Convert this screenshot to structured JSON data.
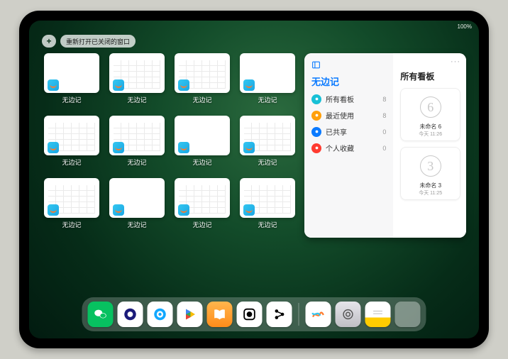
{
  "status": {
    "right": "100%"
  },
  "toolbar": {
    "plus_label": "+",
    "reopen_label": "重新打开已关闭的窗口"
  },
  "windows": {
    "app_label": "无边记",
    "items": [
      {
        "variant": "plain"
      },
      {
        "variant": "cal"
      },
      {
        "variant": "cal"
      },
      {
        "variant": "plain"
      },
      {
        "variant": "cal"
      },
      {
        "variant": "cal"
      },
      {
        "variant": "plain"
      },
      {
        "variant": "cal"
      },
      {
        "variant": "cal"
      },
      {
        "variant": "plain"
      },
      {
        "variant": "cal"
      },
      {
        "variant": "cal"
      }
    ]
  },
  "panel": {
    "title": "无边记",
    "categories": [
      {
        "color": "c-cyan",
        "label": "所有看板",
        "count": 8
      },
      {
        "color": "c-orange",
        "label": "最近使用",
        "count": 8
      },
      {
        "color": "c-blue",
        "label": "已共享",
        "count": 0
      },
      {
        "color": "c-red",
        "label": "个人收藏",
        "count": 0
      }
    ],
    "boards_title": "所有看板",
    "more_label": "···",
    "boards": [
      {
        "glyph": "6",
        "name": "未命名 6",
        "time": "今天 11:26"
      },
      {
        "glyph": "3",
        "name": "未命名 3",
        "time": "今天 11:25"
      }
    ]
  },
  "dock": {
    "apps_main": [
      {
        "id": "wechat",
        "name": "WeChat"
      },
      {
        "id": "quark",
        "name": "Quark"
      },
      {
        "id": "qqbrowser",
        "name": "QQ Browser"
      },
      {
        "id": "play",
        "name": "Play Store"
      },
      {
        "id": "books",
        "name": "Books"
      },
      {
        "id": "dice",
        "name": "Game"
      },
      {
        "id": "bt",
        "name": "Connect"
      }
    ],
    "apps_recent": [
      {
        "id": "freeform",
        "name": "Freeform"
      },
      {
        "id": "settings",
        "name": "Settings"
      },
      {
        "id": "notes",
        "name": "Notes"
      },
      {
        "id": "folder",
        "name": "App Library"
      }
    ]
  }
}
